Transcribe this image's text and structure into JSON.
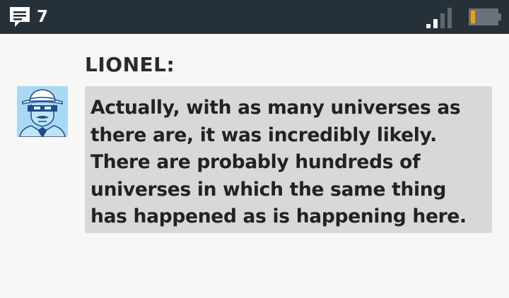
{
  "status_bar": {
    "message_count": "7",
    "icons": {
      "messages": "chat-bubble-icon",
      "signal": "signal-strength-icon",
      "battery": "battery-low-icon"
    },
    "colors": {
      "background": "#253038",
      "battery_level": "#f5a000"
    },
    "signal_bars_filled": 2,
    "signal_bars_total": 4
  },
  "dialog": {
    "speaker": "LIONEL:",
    "text": "Actually, with as many universes as there are, it was incredibly likely. There are probably hundreds of universes in which the same thing has happened as is happening here.",
    "avatar": "lionel-portrait",
    "colors": {
      "box": "#d8d8d8",
      "avatar_bg": "#a9d8f4"
    }
  }
}
